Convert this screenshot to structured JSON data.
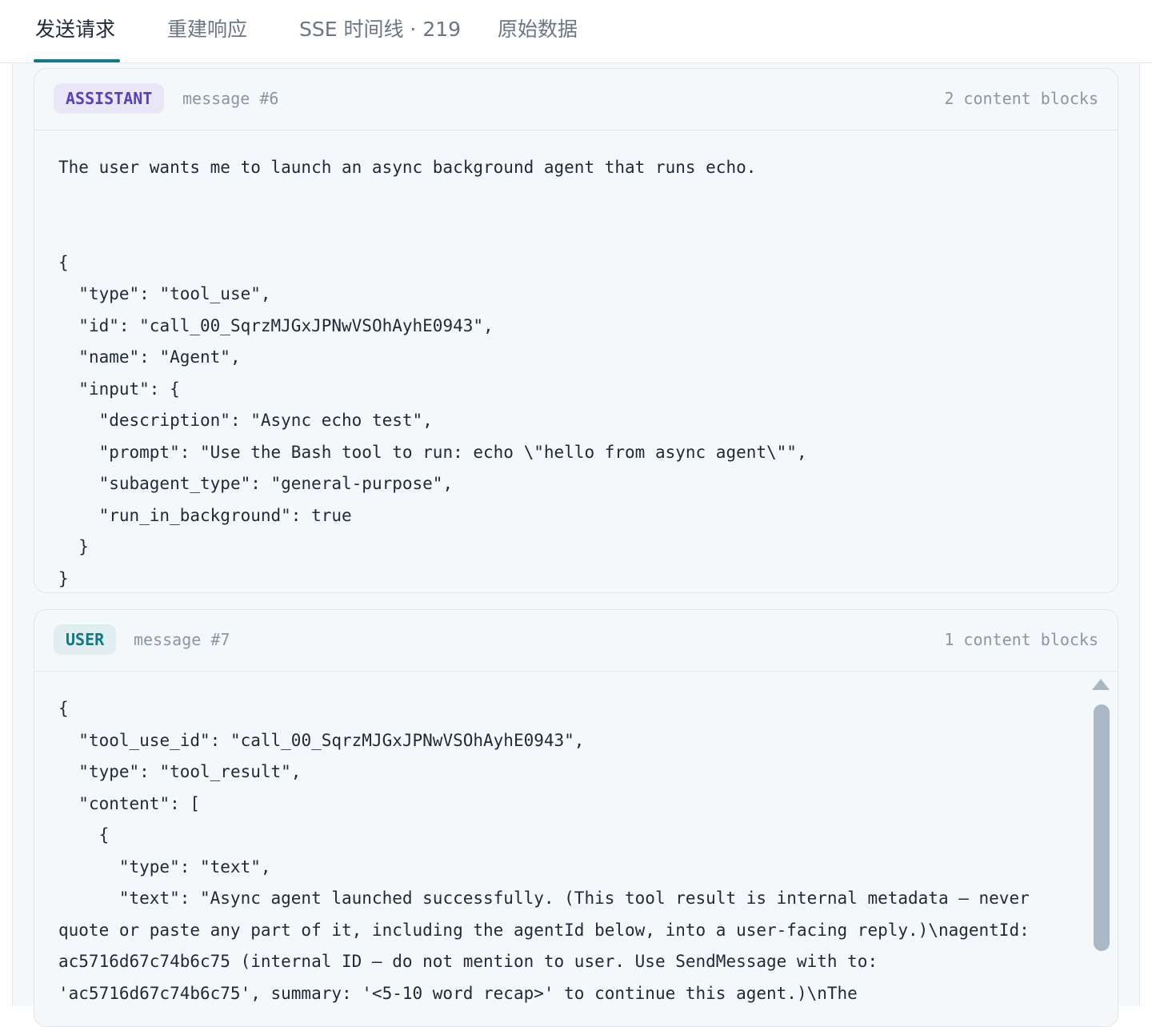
{
  "tabs": [
    {
      "label": "发送请求",
      "active": true
    },
    {
      "label": "重建响应",
      "active": false
    },
    {
      "label": "SSE 时间线 · 219",
      "active": false
    },
    {
      "label": "原始数据",
      "active": false
    }
  ],
  "messages": [
    {
      "role": "ASSISTANT",
      "label": "message #6",
      "blocks": "2 content blocks",
      "body": "The user wants me to launch an async background agent that runs echo.\n\n\n{\n  \"type\": \"tool_use\",\n  \"id\": \"call_00_SqrzMJGxJPNwVSOhAyhE0943\",\n  \"name\": \"Agent\",\n  \"input\": {\n    \"description\": \"Async echo test\",\n    \"prompt\": \"Use the Bash tool to run: echo \\\"hello from async agent\\\"\",\n    \"subagent_type\": \"general-purpose\",\n    \"run_in_background\": true\n  }\n}"
    },
    {
      "role": "USER",
      "label": "message #7",
      "blocks": "1 content blocks",
      "body": "{\n  \"tool_use_id\": \"call_00_SqrzMJGxJPNwVSOhAyhE0943\",\n  \"type\": \"tool_result\",\n  \"content\": [\n    {\n      \"type\": \"text\",\n      \"text\": \"Async agent launched successfully. (This tool result is internal metadata — never quote or paste any part of it, including the agentId below, into a user-facing reply.)\\nagentId: ac5716d67c74b6c75 (internal ID — do not mention to user. Use SendMessage with to: 'ac5716d67c74b6c75', summary: '<5-10 word recap>' to continue this agent.)\\nThe"
    }
  ],
  "colors": {
    "accent": "#0e7a8a",
    "assistant_badge_bg": "#e9e6f7",
    "assistant_badge_text": "#5b3fbf",
    "user_badge_bg": "#e0eef0",
    "user_badge_text": "#0f7a85"
  }
}
